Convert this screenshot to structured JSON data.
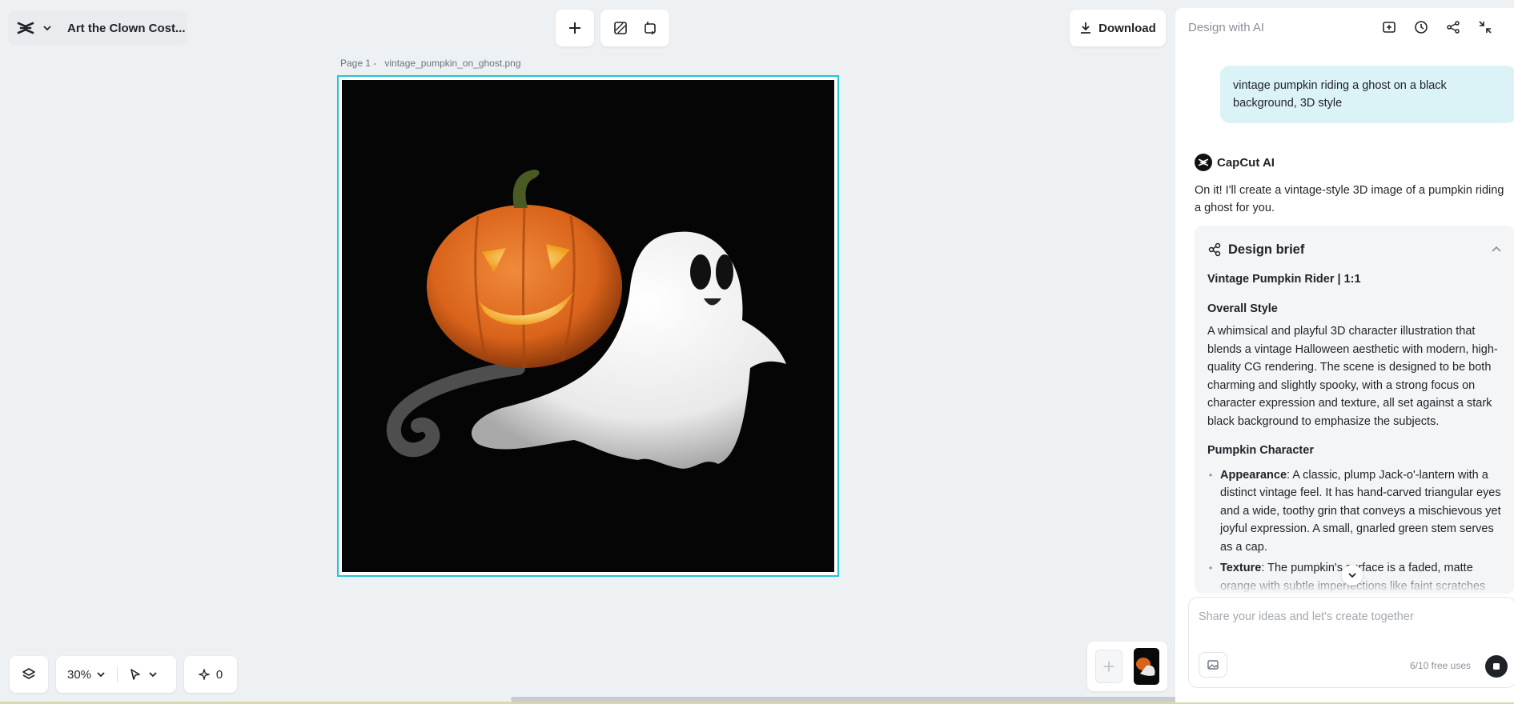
{
  "project": {
    "title": "Art the Clown Cost...",
    "logo_icon": "capcut-logo-icon",
    "menu_icon": "chevron-down-icon"
  },
  "toolbar": {
    "add_icon": "plus-icon",
    "tool1_icon": "erase-background-icon",
    "tool2_icon": "resize-canvas-icon",
    "download_label": "Download",
    "download_icon": "download-icon"
  },
  "canvas": {
    "page_label": "Page 1 -",
    "file_name": "vintage_pumpkin_on_ghost.png"
  },
  "bottom_bar": {
    "layers_icon": "layers-icon",
    "zoom": "30%",
    "pointer_icon": "cursor-icon",
    "credits_icon": "sparkle-icon",
    "credits_count": "0"
  },
  "panel": {
    "title": "Design with AI",
    "icons": [
      "new-chat-icon",
      "history-icon",
      "share-icon",
      "collapse-icon"
    ],
    "user_message": "vintage pumpkin riding a ghost on a black background, 3D style",
    "ai_name": "CapCut AI",
    "ai_message": "On it! I'll create a vintage-style 3D image of a pumpkin riding a ghost for you.",
    "brief": {
      "title": "Design brief",
      "subtitle": "Vintage Pumpkin Rider | 1:1",
      "overall_heading": "Overall Style",
      "overall_text": "A whimsical and playful 3D character illustration that blends a vintage Halloween aesthetic with modern, high-quality CG rendering. The scene is designed to be both charming and slightly spooky, with a strong focus on character expression and texture, all set against a stark black background to emphasize the subjects.",
      "pumpkin_heading": "Pumpkin Character",
      "items": [
        {
          "label": "Appearance",
          "text": ": A classic, plump Jack-o'-lantern with a distinct vintage feel. It has hand-carved triangular eyes and a wide, toothy grin that conveys a mischievous yet joyful expression. A small, gnarled green stem serves as a cap."
        },
        {
          "label": "Texture",
          "text": ": The pumpkin's surface is a faded, matte orange with subtle imperfections like faint scratches and color variations, suggesting it's an old, well-loved object."
        }
      ]
    },
    "input": {
      "placeholder": "Share your ideas and let's create together",
      "uses": "6/10 free uses"
    }
  },
  "colors": {
    "accent": "#22c4d6",
    "user_bubble": "#dbf2f6",
    "background": "#eef1f4"
  }
}
